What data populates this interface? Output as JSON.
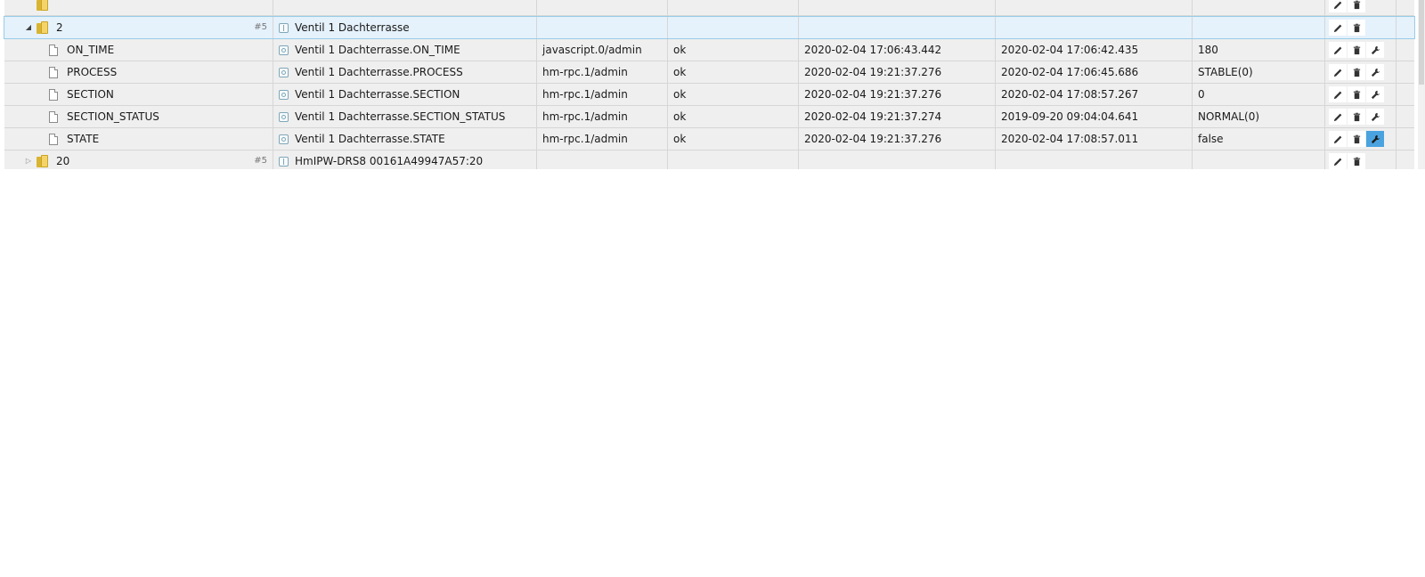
{
  "rows": [
    {
      "kind": "partial",
      "name": "",
      "from": "",
      "q": "",
      "ts": "",
      "lc": "",
      "val": ""
    },
    {
      "kind": "folder-open",
      "id": "2",
      "count": "#5",
      "name": "Ventil 1 Dachterrasse",
      "from": "",
      "q": "",
      "ts": "",
      "lc": "",
      "val": ""
    },
    {
      "kind": "state",
      "id": "ON_TIME",
      "name": "Ventil 1 Dachterrasse.ON_TIME",
      "from": "javascript.0/admin",
      "q": "ok",
      "ts": "2020-02-04 17:06:43.442",
      "lc": "2020-02-04 17:06:42.435",
      "val": "180"
    },
    {
      "kind": "state",
      "id": "PROCESS",
      "name": "Ventil 1 Dachterrasse.PROCESS",
      "from": "hm-rpc.1/admin",
      "q": "ok",
      "ts": "2020-02-04 19:21:37.276",
      "lc": "2020-02-04 17:06:45.686",
      "val": "STABLE(0)"
    },
    {
      "kind": "state",
      "id": "SECTION",
      "name": "Ventil 1 Dachterrasse.SECTION",
      "from": "hm-rpc.1/admin",
      "q": "ok",
      "ts": "2020-02-04 19:21:37.276",
      "lc": "2020-02-04 17:08:57.267",
      "val": "0"
    },
    {
      "kind": "state",
      "id": "SECTION_STATUS",
      "name": "Ventil 1 Dachterrasse.SECTION_STATUS",
      "from": "hm-rpc.1/admin",
      "q": "ok",
      "ts": "2020-02-04 19:21:37.274",
      "lc": "2019-09-20 09:04:04.641",
      "val": "NORMAL(0)"
    },
    {
      "kind": "state",
      "id": "STATE",
      "name": "Ventil 1 Dachterrasse.STATE",
      "from": "hm-rpc.1/admin",
      "q": "ok",
      "ts": "2020-02-04 19:21:37.276",
      "lc": "2020-02-04 17:08:57.011",
      "val": "false"
    },
    {
      "kind": "folder-closed",
      "id": "20",
      "count": "#5",
      "name": "HmIPW-DRS8 00161A49947A57:20",
      "from": "",
      "q": "",
      "ts": "",
      "lc": "",
      "val": ""
    },
    {
      "kind": "partial",
      "name": "",
      "from": "",
      "q": "",
      "ts": "",
      "lc": "",
      "val": ""
    }
  ],
  "icons": {
    "edit": "pencil-icon",
    "delete": "trash-icon",
    "custom": "wrench-icon"
  },
  "colors": {
    "row_bg": "#efefef",
    "selected_bg": "#e5f1fb",
    "selected_border": "#99cce8",
    "active_button": "#4aa3df"
  }
}
